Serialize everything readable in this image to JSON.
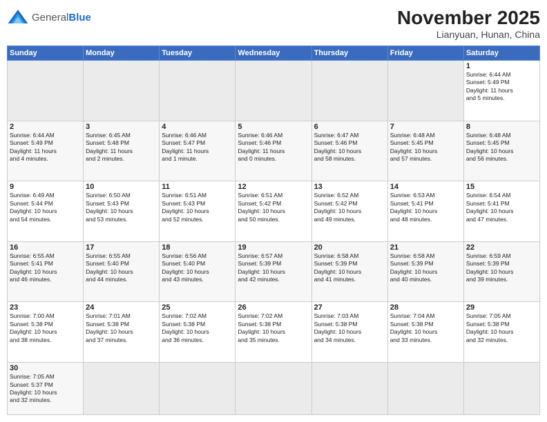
{
  "header": {
    "logo_line1": "General",
    "logo_line2": "Blue",
    "month_title": "November 2025",
    "location": "Lianyuan, Hunan, China"
  },
  "weekdays": [
    "Sunday",
    "Monday",
    "Tuesday",
    "Wednesday",
    "Thursday",
    "Friday",
    "Saturday"
  ],
  "weeks": [
    [
      {
        "day": "",
        "info": ""
      },
      {
        "day": "",
        "info": ""
      },
      {
        "day": "",
        "info": ""
      },
      {
        "day": "",
        "info": ""
      },
      {
        "day": "",
        "info": ""
      },
      {
        "day": "",
        "info": ""
      },
      {
        "day": "1",
        "info": "Sunrise: 6:44 AM\nSunset: 5:49 PM\nDaylight: 11 hours\nand 5 minutes."
      }
    ],
    [
      {
        "day": "2",
        "info": "Sunrise: 6:44 AM\nSunset: 5:49 PM\nDaylight: 11 hours\nand 4 minutes."
      },
      {
        "day": "3",
        "info": "Sunrise: 6:45 AM\nSunset: 5:48 PM\nDaylight: 11 hours\nand 2 minutes."
      },
      {
        "day": "4",
        "info": "Sunrise: 6:46 AM\nSunset: 5:47 PM\nDaylight: 11 hours\nand 1 minute."
      },
      {
        "day": "5",
        "info": "Sunrise: 6:46 AM\nSunset: 5:46 PM\nDaylight: 11 hours\nand 0 minutes."
      },
      {
        "day": "6",
        "info": "Sunrise: 6:47 AM\nSunset: 5:46 PM\nDaylight: 10 hours\nand 58 minutes."
      },
      {
        "day": "7",
        "info": "Sunrise: 6:48 AM\nSunset: 5:45 PM\nDaylight: 10 hours\nand 57 minutes."
      },
      {
        "day": "8",
        "info": "Sunrise: 6:48 AM\nSunset: 5:45 PM\nDaylight: 10 hours\nand 56 minutes."
      }
    ],
    [
      {
        "day": "9",
        "info": "Sunrise: 6:49 AM\nSunset: 5:44 PM\nDaylight: 10 hours\nand 54 minutes."
      },
      {
        "day": "10",
        "info": "Sunrise: 6:50 AM\nSunset: 5:43 PM\nDaylight: 10 hours\nand 53 minutes."
      },
      {
        "day": "11",
        "info": "Sunrise: 6:51 AM\nSunset: 5:43 PM\nDaylight: 10 hours\nand 52 minutes."
      },
      {
        "day": "12",
        "info": "Sunrise: 6:51 AM\nSunset: 5:42 PM\nDaylight: 10 hours\nand 50 minutes."
      },
      {
        "day": "13",
        "info": "Sunrise: 6:52 AM\nSunset: 5:42 PM\nDaylight: 10 hours\nand 49 minutes."
      },
      {
        "day": "14",
        "info": "Sunrise: 6:53 AM\nSunset: 5:41 PM\nDaylight: 10 hours\nand 48 minutes."
      },
      {
        "day": "15",
        "info": "Sunrise: 6:54 AM\nSunset: 5:41 PM\nDaylight: 10 hours\nand 47 minutes."
      }
    ],
    [
      {
        "day": "16",
        "info": "Sunrise: 6:55 AM\nSunset: 5:41 PM\nDaylight: 10 hours\nand 46 minutes."
      },
      {
        "day": "17",
        "info": "Sunrise: 6:55 AM\nSunset: 5:40 PM\nDaylight: 10 hours\nand 44 minutes."
      },
      {
        "day": "18",
        "info": "Sunrise: 6:56 AM\nSunset: 5:40 PM\nDaylight: 10 hours\nand 43 minutes."
      },
      {
        "day": "19",
        "info": "Sunrise: 6:57 AM\nSunset: 5:39 PM\nDaylight: 10 hours\nand 42 minutes."
      },
      {
        "day": "20",
        "info": "Sunrise: 6:58 AM\nSunset: 5:39 PM\nDaylight: 10 hours\nand 41 minutes."
      },
      {
        "day": "21",
        "info": "Sunrise: 6:58 AM\nSunset: 5:39 PM\nDaylight: 10 hours\nand 40 minutes."
      },
      {
        "day": "22",
        "info": "Sunrise: 6:59 AM\nSunset: 5:39 PM\nDaylight: 10 hours\nand 39 minutes."
      }
    ],
    [
      {
        "day": "23",
        "info": "Sunrise: 7:00 AM\nSunset: 5:38 PM\nDaylight: 10 hours\nand 38 minutes."
      },
      {
        "day": "24",
        "info": "Sunrise: 7:01 AM\nSunset: 5:38 PM\nDaylight: 10 hours\nand 37 minutes."
      },
      {
        "day": "25",
        "info": "Sunrise: 7:02 AM\nSunset: 5:38 PM\nDaylight: 10 hours\nand 36 minutes."
      },
      {
        "day": "26",
        "info": "Sunrise: 7:02 AM\nSunset: 5:38 PM\nDaylight: 10 hours\nand 35 minutes."
      },
      {
        "day": "27",
        "info": "Sunrise: 7:03 AM\nSunset: 5:38 PM\nDaylight: 10 hours\nand 34 minutes."
      },
      {
        "day": "28",
        "info": "Sunrise: 7:04 AM\nSunset: 5:38 PM\nDaylight: 10 hours\nand 33 minutes."
      },
      {
        "day": "29",
        "info": "Sunrise: 7:05 AM\nSunset: 5:38 PM\nDaylight: 10 hours\nand 32 minutes."
      }
    ],
    [
      {
        "day": "30",
        "info": "Sunrise: 7:05 AM\nSunset: 5:37 PM\nDaylight: 10 hours\nand 32 minutes."
      },
      {
        "day": "",
        "info": ""
      },
      {
        "day": "",
        "info": ""
      },
      {
        "day": "",
        "info": ""
      },
      {
        "day": "",
        "info": ""
      },
      {
        "day": "",
        "info": ""
      },
      {
        "day": "",
        "info": ""
      }
    ]
  ]
}
